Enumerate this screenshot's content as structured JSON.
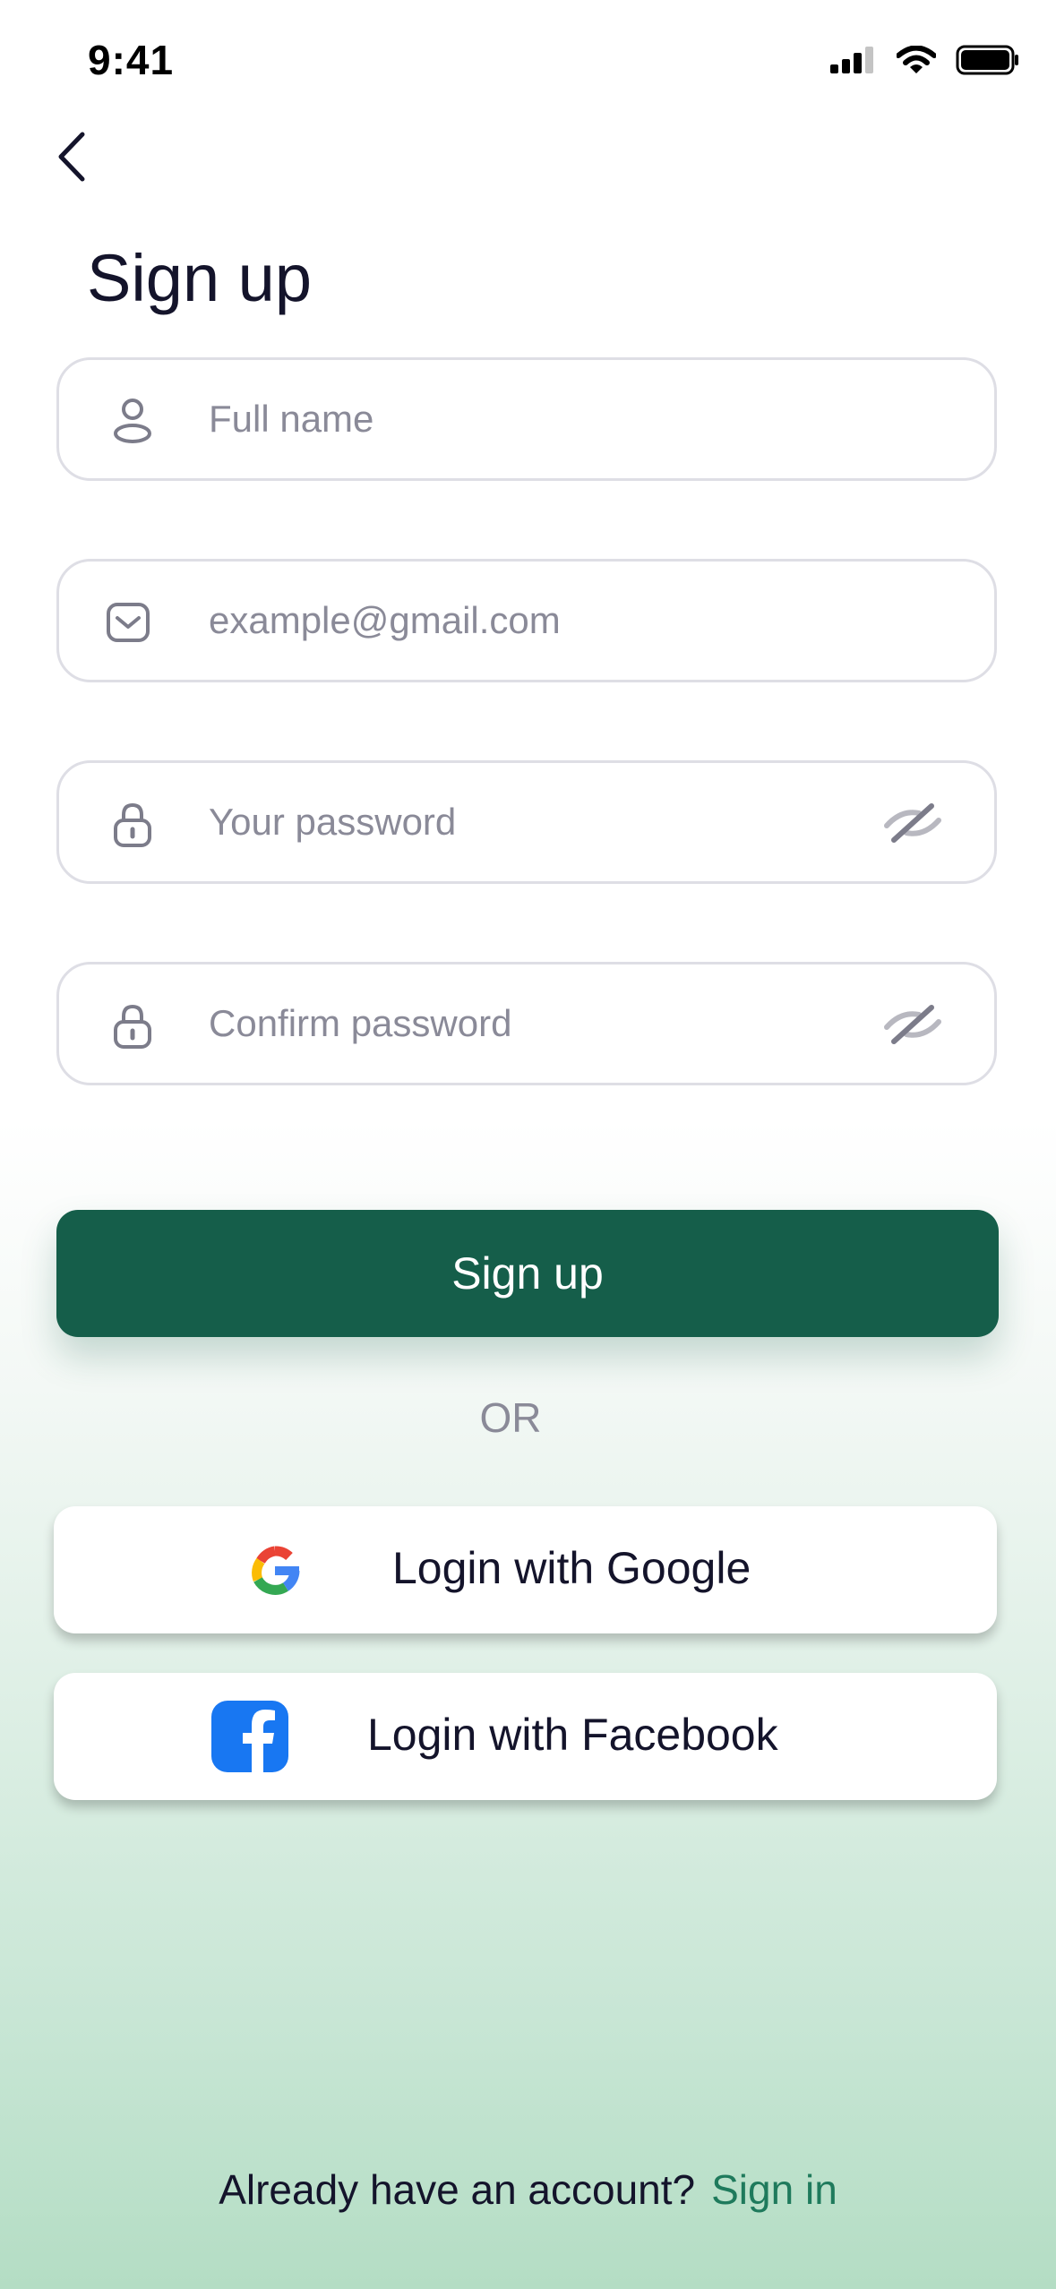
{
  "status_bar": {
    "time": "9:41"
  },
  "header": {
    "title": "Sign up"
  },
  "form": {
    "full_name": {
      "placeholder": "Full name",
      "value": ""
    },
    "email": {
      "placeholder": "example@gmail.com",
      "value": ""
    },
    "password": {
      "placeholder": "Your password",
      "value": ""
    },
    "confirm_password": {
      "placeholder": "Confirm password",
      "value": ""
    }
  },
  "actions": {
    "signup_label": "Sign up",
    "or_label": "OR",
    "google_label": "Login with Google",
    "facebook_label": "Login with Facebook"
  },
  "footer": {
    "prompt": "Already have an account?",
    "link": "Sign in"
  },
  "colors": {
    "primary": "#155e4a",
    "link": "#1f7a5c",
    "facebook": "#1877f2"
  },
  "icons": [
    "signal-icon",
    "wifi-icon",
    "battery-icon",
    "back-arrow-icon",
    "user-icon",
    "mail-icon",
    "lock-icon",
    "eye-hidden-icon",
    "google-icon",
    "facebook-icon"
  ]
}
